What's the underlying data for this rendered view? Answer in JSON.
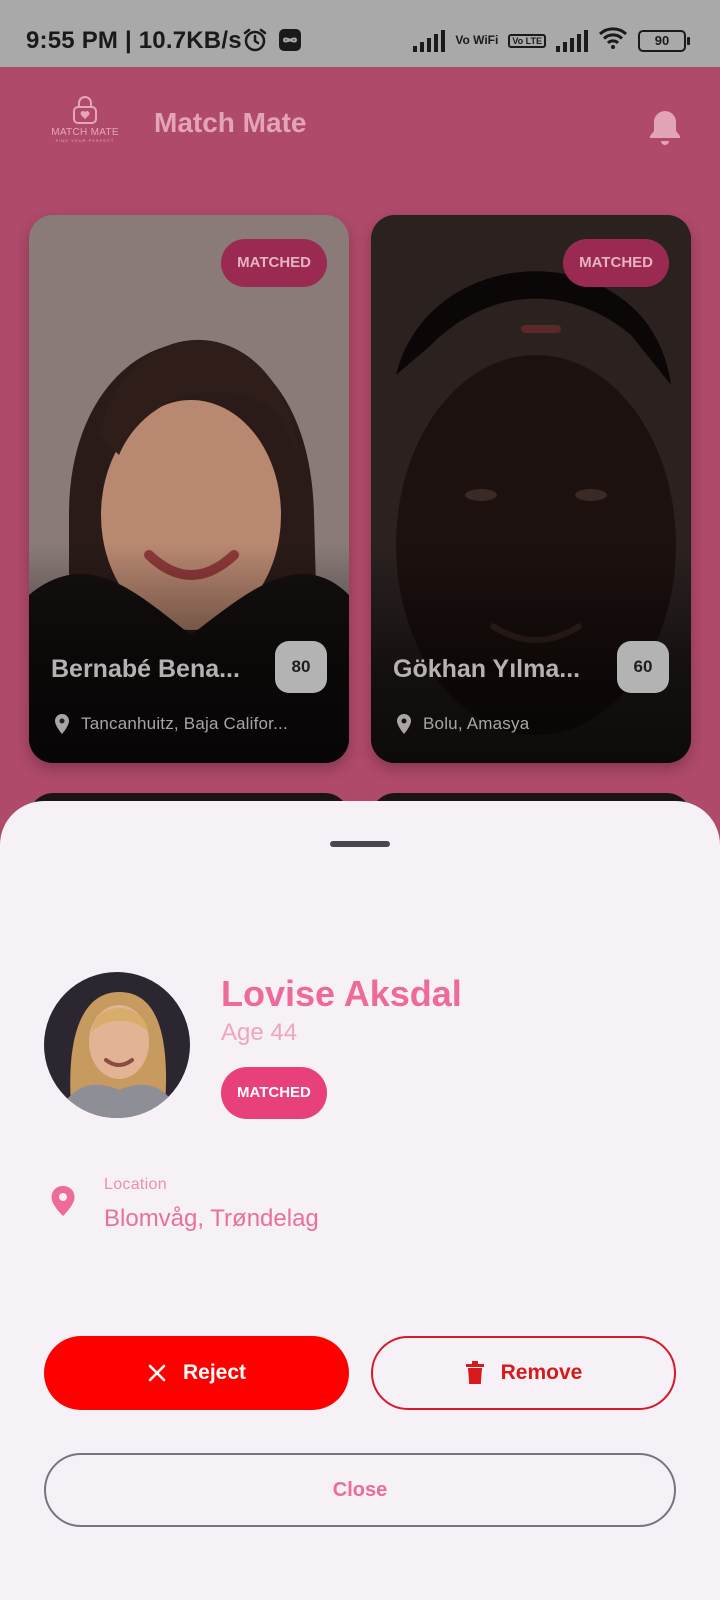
{
  "status_bar": {
    "time": "9:55 PM | 10.7KB/s",
    "vowifi": "Vo WiFi",
    "volte": "Vo LTE",
    "battery": "90"
  },
  "header": {
    "logo_text": "MATCH MATE",
    "logo_subtext": "FIND YOUR PERFECT",
    "title": "Match Mate",
    "notification_icon": "bell-icon"
  },
  "cards": [
    {
      "status": "MATCHED",
      "name": "Bernabé Bena...",
      "score": "80",
      "location": "Tancanhuitz, Baja Califor..."
    },
    {
      "status": "MATCHED",
      "name": "Gökhan Yılma...",
      "score": "60",
      "location": "Bolu, Amasya"
    }
  ],
  "sheet": {
    "name": "Lovise Aksdal",
    "age": "Age 44",
    "status": "MATCHED",
    "location_label": "Location",
    "location_value": "Blomvåg, Trøndelag",
    "reject_label": "Reject",
    "remove_label": "Remove",
    "close_label": "Close"
  },
  "colors": {
    "accent_pink": "#e8407a",
    "reject_red": "#ff0000",
    "remove_outline": "#d61a2a",
    "background": "#b04a6a",
    "sheet_bg": "#f6f0f7"
  }
}
